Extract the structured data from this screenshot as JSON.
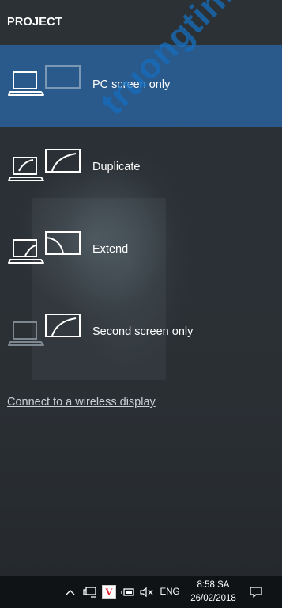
{
  "panel": {
    "title": "PROJECT",
    "options": [
      {
        "label": "PC screen only",
        "selected": true
      },
      {
        "label": "Duplicate",
        "selected": false
      },
      {
        "label": "Extend",
        "selected": false
      },
      {
        "label": "Second screen only",
        "selected": false
      }
    ],
    "wireless_link": "Connect to a wireless display"
  },
  "watermark": "truongtin.top",
  "taskbar": {
    "icons": [
      "chevron-up-icon",
      "network-icon",
      "antivirus-icon",
      "battery-icon",
      "volume-muted-icon",
      "notification-icon"
    ],
    "antivirus_letter": "V",
    "language": "ENG",
    "time": "8:58 SA",
    "date": "26/02/2018"
  },
  "colors": {
    "accent": "#2a5a8c",
    "background": "#2a2f34",
    "taskbar": "#101315",
    "antivirus": "#e3262b"
  }
}
